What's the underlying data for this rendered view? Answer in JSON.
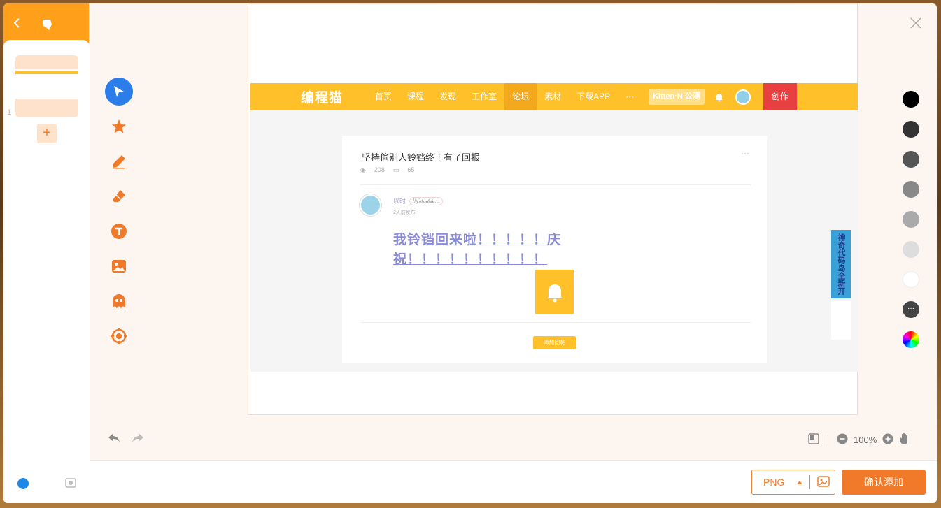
{
  "left_panel": {
    "back_icon": "chevron-left-icon",
    "logo_icon": "app-logo-icon",
    "page_number": "1",
    "add_page_label": "+"
  },
  "tools": [
    "pointer-icon",
    "star-icon",
    "pen-icon",
    "eraser-icon",
    "text-icon",
    "image-icon",
    "ghost-icon",
    "target-icon"
  ],
  "screenshot": {
    "nav": {
      "logo": "编程猫",
      "items": [
        "首页",
        "课程",
        "发现",
        "工作室",
        "论坛",
        "素材",
        "下载APP",
        "···"
      ],
      "active_item": "论坛",
      "badge": "Kitten·N 公测",
      "create": "创作"
    },
    "post": {
      "title": "坚持偷别人铃铛终于有了回报",
      "more": "···",
      "views": "208",
      "comments": "65",
      "author": "以时",
      "author_tag": "//yλω𝓭𝓭𝓸...",
      "time": "2天前发布",
      "content": "我铃铛回来啦！！！！！庆祝！！！！！！！！！！",
      "button": "添加回帖"
    },
    "side_banner": "神奇代码岛全新开启"
  },
  "palette": [
    "#000000",
    "#333333",
    "#555555",
    "#888888",
    "#aaaaaa",
    "#dddddd",
    "#ffffff",
    "#444444",
    "rainbow"
  ],
  "zoom": {
    "level": "100%"
  },
  "footer": {
    "format": "PNG",
    "confirm": "确认添加"
  }
}
